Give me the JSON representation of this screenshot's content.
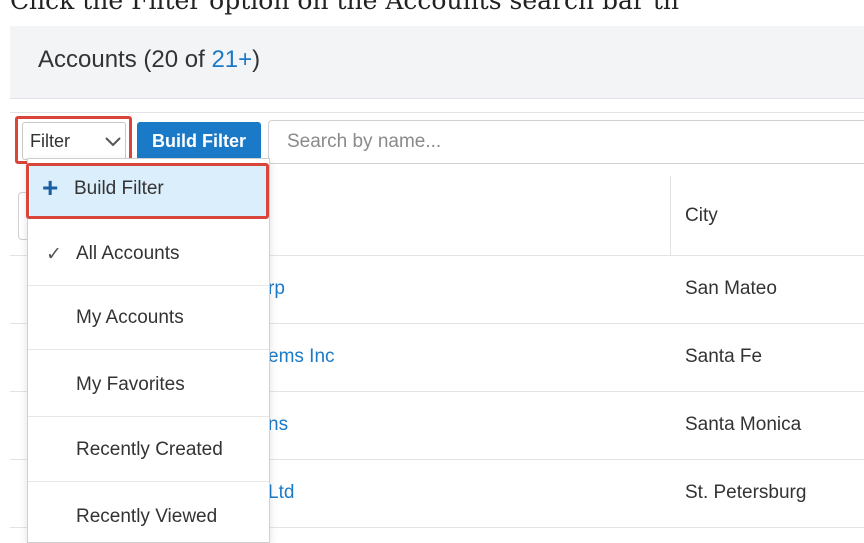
{
  "caption": "Click the Filter option on the Accounts search bar th",
  "header": {
    "title": "Accounts (20 of ",
    "count": "21+",
    "close_paren": ")"
  },
  "toolbar": {
    "filter_label": "Filter",
    "build_filter_label": "Build Filter",
    "search_placeholder": "Search by name..."
  },
  "table": {
    "columns": [
      "City"
    ],
    "rows": [
      {
        "name": "rp",
        "city": "San Mateo"
      },
      {
        "name": "ems Inc",
        "city": "Santa Fe"
      },
      {
        "name": "ns",
        "city": "Santa Monica"
      },
      {
        "name": "Ltd",
        "city": "St. Petersburg"
      }
    ]
  },
  "dropdown": {
    "build_filter": "Build Filter",
    "items": [
      {
        "label": "All Accounts",
        "checked": true
      },
      {
        "label": "My Accounts",
        "checked": false
      },
      {
        "label": "My Favorites",
        "checked": false
      },
      {
        "label": "Recently Created",
        "checked": false
      },
      {
        "label": "Recently Viewed",
        "checked": false
      }
    ]
  },
  "colors": {
    "accent": "#1b7ac7",
    "highlight": "#d9453a",
    "selected_bg": "#dbeefc"
  }
}
